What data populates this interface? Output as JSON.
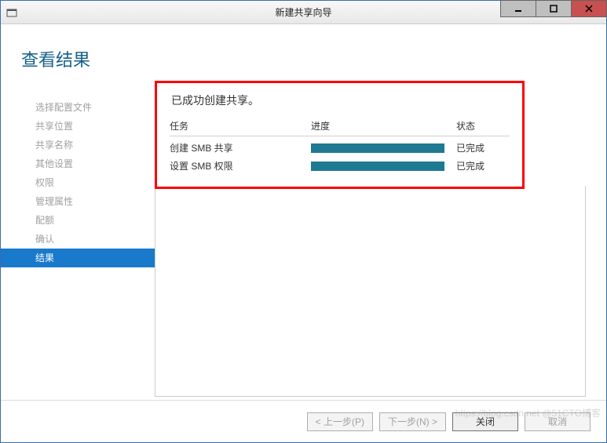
{
  "window": {
    "title": "新建共享向导"
  },
  "page": {
    "heading": "查看结果"
  },
  "sidebar": {
    "items": [
      {
        "label": "选择配置文件",
        "active": false
      },
      {
        "label": "共享位置",
        "active": false
      },
      {
        "label": "共享名称",
        "active": false
      },
      {
        "label": "其他设置",
        "active": false
      },
      {
        "label": "权限",
        "active": false
      },
      {
        "label": "管理属性",
        "active": false
      },
      {
        "label": "配额",
        "active": false
      },
      {
        "label": "确认",
        "active": false
      },
      {
        "label": "结果",
        "active": true
      }
    ]
  },
  "results": {
    "message": "已成功创建共享。",
    "columns": {
      "task": "任务",
      "progress": "进度",
      "status": "状态"
    },
    "rows": [
      {
        "task": "创建 SMB 共享",
        "status": "已完成"
      },
      {
        "task": "设置 SMB 权限",
        "status": "已完成"
      }
    ]
  },
  "footer": {
    "prev": "< 上一步(P)",
    "next": "下一步(N) >",
    "close": "关闭",
    "cancel": "取消"
  },
  "watermark": "https://blog.csdn.net @51CTO博客"
}
